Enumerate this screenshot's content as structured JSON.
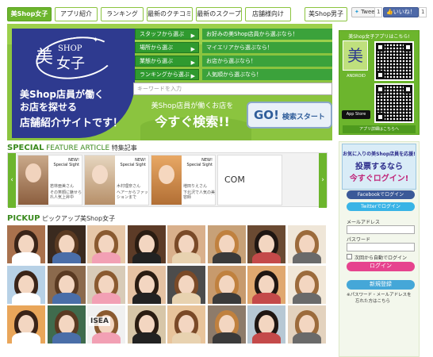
{
  "nav": {
    "tabs": [
      "美Shop女子",
      "アプリ紹介",
      "ランキング",
      "最新のクチコミ",
      "最新のスクープ",
      "店舗様向け",
      "美Shop男子"
    ],
    "tweet": "Tweet",
    "tweet_count": "1",
    "like": "いいね！",
    "like_count": "1"
  },
  "hero": {
    "logo_top": "美",
    "logo_shop": "SHOP",
    "logo_bottom": "女子",
    "line1": "美Shop店員が働く",
    "line2": "お店を探せる",
    "line3": "店舗紹介サイトです！",
    "filters": [
      {
        "button": "スタッフから選ぶ",
        "label": "お好みの美Shop店員から選ぶなら！"
      },
      {
        "button": "場所から選ぶ",
        "label": "マイエリアから選ぶなら！"
      },
      {
        "button": "業態から選ぶ",
        "label": "お店から選ぶなら！"
      },
      {
        "button": "ランキングから選ぶ",
        "label": "人気順から選ぶなら！"
      }
    ],
    "keyword_placeholder": "キーワードを入力",
    "cta_small": "美Shop店員が働くお店を",
    "cta_big": "今すぐ検索!!",
    "go_button": "GO!",
    "go_sub": "検索スタート"
  },
  "qr": {
    "title": "美Shop女子アプリはこちら!",
    "android": "ANDROID",
    "appstore": "App Store",
    "detail": "アプリ詳細はこちらへ"
  },
  "special": {
    "title": "SPECIAL",
    "title2": "FEATURE ARTICLE",
    "subtitle": "特集記事",
    "cards": [
      {
        "new": "NEW!",
        "tag": "Special Sight",
        "name": "若林亜美さん",
        "desc": "その笑顔に魅せられ人気上昇中"
      },
      {
        "new": "NEW!",
        "tag": "Special Sight",
        "name": "木村理奈さん",
        "desc": "ヘアーからファッションまで"
      },
      {
        "new": "NEW!",
        "tag": "Special Sight",
        "name": "増田りえさん",
        "desc": "下北沢で人気の美容師"
      }
    ],
    "more": "COM"
  },
  "pickup": {
    "title": "PICKUP",
    "subtitle": "ピックアップ美Shop女子",
    "sign_text": "ISEA"
  },
  "login": {
    "ad_line1": "お気に入りの美Shop店員を応援!",
    "ad_line2": "投票するなら",
    "ad_line3": "今すぐログイン!",
    "facebook": "Facebookでログイン",
    "twitter": "Twitterでログイン",
    "email_label": "メールアドレス",
    "password_label": "パスワード",
    "remember": "次回から自動でログイン",
    "login_button": "ログイン",
    "register_button": "新規登録",
    "forgot_line1": "※パスワード・メールアドレスを",
    "forgot_line2": "忘れた方はこちら"
  }
}
